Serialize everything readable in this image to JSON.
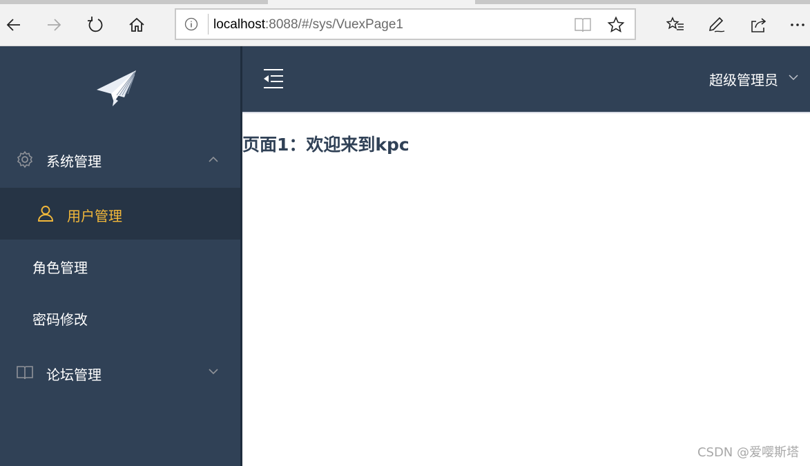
{
  "browser": {
    "url_host": "localhost",
    "url_path": ":8088/#/sys/VuexPage1",
    "icons": [
      "back-arrow-icon",
      "forward-arrow-icon",
      "refresh-icon",
      "home-icon",
      "info-icon",
      "reading-view-icon",
      "favorite-star-icon",
      "favorites-list-icon",
      "pen-icon",
      "share-icon",
      "more-icon"
    ]
  },
  "sidebar": {
    "menus": [
      {
        "label": "系统管理",
        "icon": "gear-icon",
        "expanded": true
      },
      {
        "label": "用户管理",
        "icon": "user-icon",
        "active": true
      },
      {
        "label": "角色管理"
      },
      {
        "label": "密码修改"
      },
      {
        "label": "论坛管理",
        "icon": "book-icon",
        "expanded": false
      }
    ]
  },
  "header": {
    "user_name": "超级管理员"
  },
  "main": {
    "title": "页面1：欢迎来到kpc"
  },
  "watermark": "CSDN @爱嘤斯塔",
  "colors": {
    "sidebar_bg": "#304156",
    "active_bg": "#263445",
    "active_text": "#f4b93a",
    "title_text": "#304156"
  }
}
